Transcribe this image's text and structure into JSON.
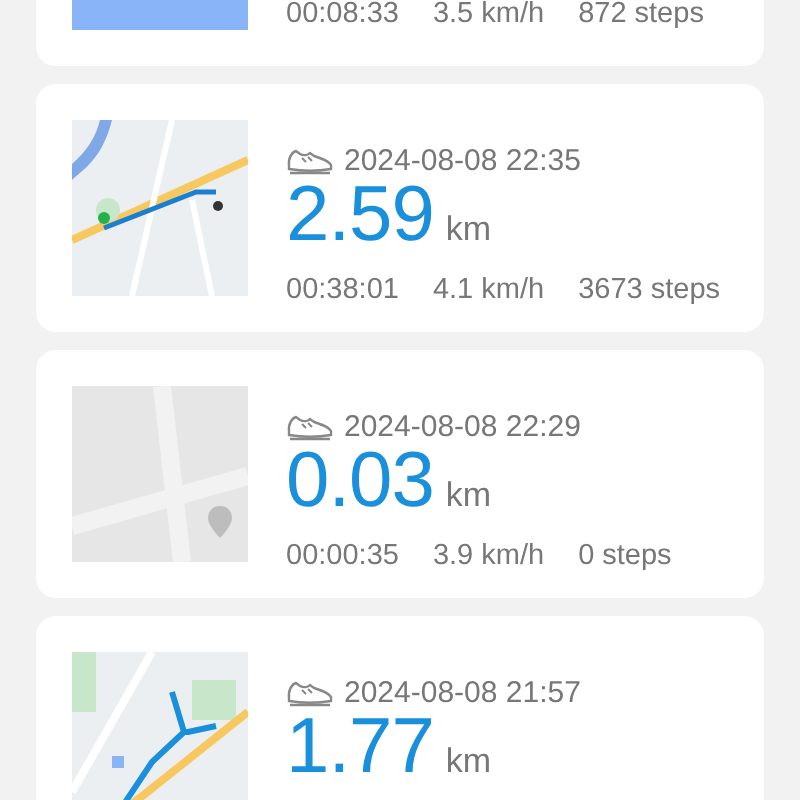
{
  "workouts": [
    {
      "duration": "00:08:33",
      "speed": "3.5 km/h",
      "steps": "872 steps"
    },
    {
      "date": "2024-08-08 22:35",
      "distance": "2.59",
      "unit": "km",
      "duration": "00:38:01",
      "speed": "4.1 km/h",
      "steps": "3673 steps"
    },
    {
      "date": "2024-08-08 22:29",
      "distance": "0.03",
      "unit": "km",
      "duration": "00:00:35",
      "speed": "3.9 km/h",
      "steps": "0 steps"
    },
    {
      "date": "2024-08-08 21:57",
      "distance": "1.77",
      "unit": "km"
    }
  ]
}
